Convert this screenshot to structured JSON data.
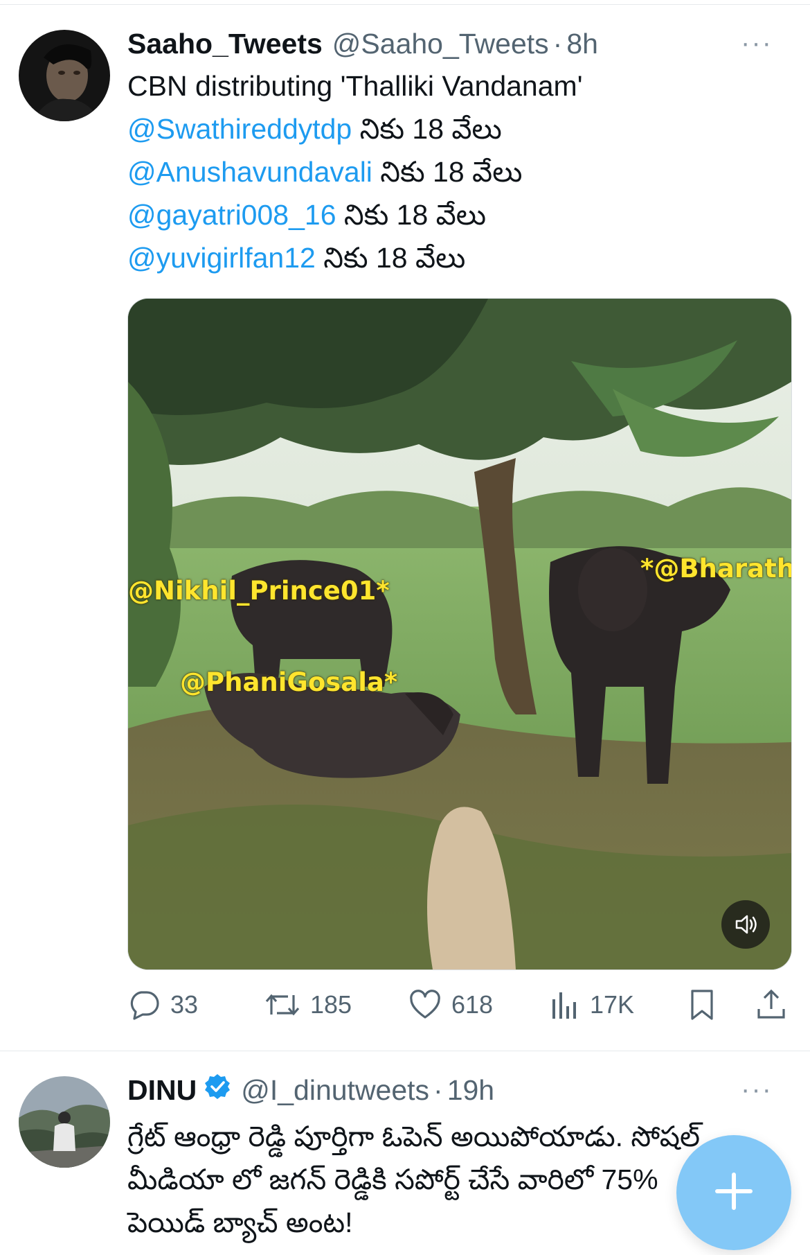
{
  "tweet1": {
    "name": "Saaho_Tweets",
    "handle": "@Saaho_Tweets",
    "separator": "·",
    "time": "8h",
    "more": "···",
    "text_first": "CBN distributing 'Thalliki Vandanam'",
    "lines": [
      {
        "mention": "@Swathireddytdp",
        "suffix": " నికు 18 వేలు"
      },
      {
        "mention": "@Anushavundavali",
        "suffix": " నికు 18 వేలు"
      },
      {
        "mention": "@gayatri008_16",
        "suffix": " నికు 18 వేలు"
      },
      {
        "mention": "@yuvigirlfan12",
        "suffix": " నికు 18 వేలు"
      }
    ],
    "media_overlays": [
      "@Nikhil_Prince01*",
      "@PhaniGosala*",
      "*@BharathGo"
    ],
    "actions": {
      "replies": "33",
      "retweets": "185",
      "likes": "618",
      "views": "17K"
    }
  },
  "tweet2": {
    "name": "DINU",
    "handle": "@I_dinutweets",
    "separator": "·",
    "time": "19h",
    "more": "···",
    "lines": [
      "గ్రేట్ ఆంధ్రా రెడ్డి పూర్తిగా ఓపెన్ అయిపోయాడు. సోషల్",
      "మీడియా లో జగన్ రెడ్డికి సపోర్ట్ చేసే వారిలో 75%",
      "పెయిడ్ బ్యాచ్ అంట!"
    ]
  },
  "colors": {
    "accent": "#1d9bf0",
    "muted": "#536471",
    "overlay_yellow": "#ffe52e",
    "fab": "#8ecdf8"
  },
  "icons": {
    "reply": "speech-bubble-icon",
    "retweet": "retweet-icon",
    "like": "heart-icon",
    "views": "bar-chart-icon",
    "bookmark": "bookmark-icon",
    "share": "share-icon",
    "verified": "verified-badge-icon",
    "mute": "speaker-icon",
    "compose": "plus-icon"
  }
}
